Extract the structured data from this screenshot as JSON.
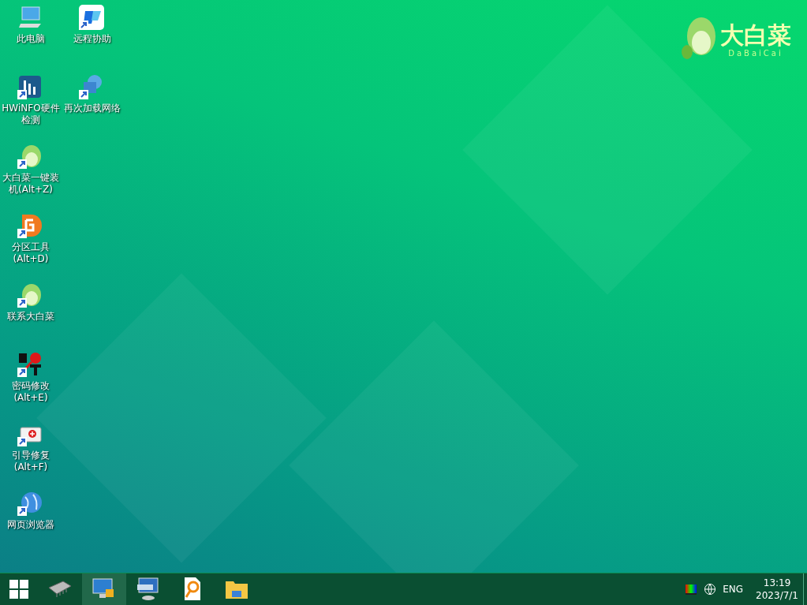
{
  "desktop": {
    "icons": [
      {
        "kind": "computer",
        "label": "此电脑",
        "shortcut": false
      },
      {
        "kind": "hwinfo",
        "label": "HWiNFO硬件检测",
        "shortcut": true
      },
      {
        "kind": "cabbage",
        "label": "大白菜一键装机(Alt+Z)",
        "shortcut": true
      },
      {
        "kind": "partition",
        "label": "分区工具(Alt+D)",
        "shortcut": true
      },
      {
        "kind": "cabbage",
        "label": "联系大白菜",
        "shortcut": true
      },
      {
        "kind": "password",
        "label": "密码修改(Alt+E)",
        "shortcut": true
      },
      {
        "kind": "repair",
        "label": "引导修复(Alt+F)",
        "shortcut": true
      },
      {
        "kind": "browser",
        "label": "网页浏览器",
        "shortcut": true
      },
      {
        "kind": "remote",
        "label": "远程协助",
        "shortcut": true
      },
      {
        "kind": "network",
        "label": "再次加载网络",
        "shortcut": true
      }
    ]
  },
  "logo": {
    "title": "大白菜",
    "subtitle": "DaBaiCai"
  },
  "taskbar": {
    "items": [
      {
        "kind": "chip",
        "selected": false
      },
      {
        "kind": "monitor",
        "selected": true
      },
      {
        "kind": "keyboard",
        "selected": false
      },
      {
        "kind": "search-doc",
        "selected": false
      },
      {
        "kind": "folder",
        "selected": false
      }
    ],
    "language": "ENG",
    "time": "13:19",
    "date": "2023/7/1"
  }
}
